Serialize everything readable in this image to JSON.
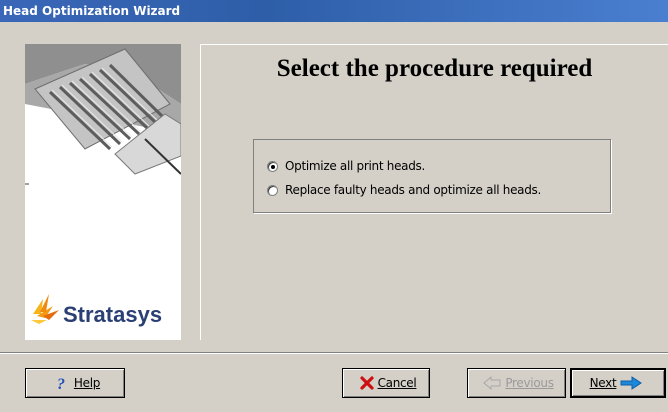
{
  "window": {
    "title": "Head Optimization Wizard"
  },
  "brand": {
    "logo_text": "Stratasys"
  },
  "main": {
    "heading": "Select the procedure required",
    "options": [
      {
        "label": "Optimize all print heads.",
        "checked": true
      },
      {
        "label": "Replace faulty heads and optimize all heads.",
        "checked": false
      }
    ]
  },
  "footer": {
    "help_label": "Help",
    "cancel_label": "Cancel",
    "previous_label": "Previous",
    "next_label": "Next"
  },
  "icons": {
    "help": "question-mark-icon",
    "cancel": "red-x-icon",
    "previous": "back-arrow-icon",
    "next": "blue-arrow-icon"
  },
  "colors": {
    "titlebar": "#3a67b8",
    "dialog_bg": "#d4d0c8",
    "logo_blue": "#2a3f73",
    "cancel_red": "#cc1010",
    "next_blue": "#1e88d8"
  }
}
